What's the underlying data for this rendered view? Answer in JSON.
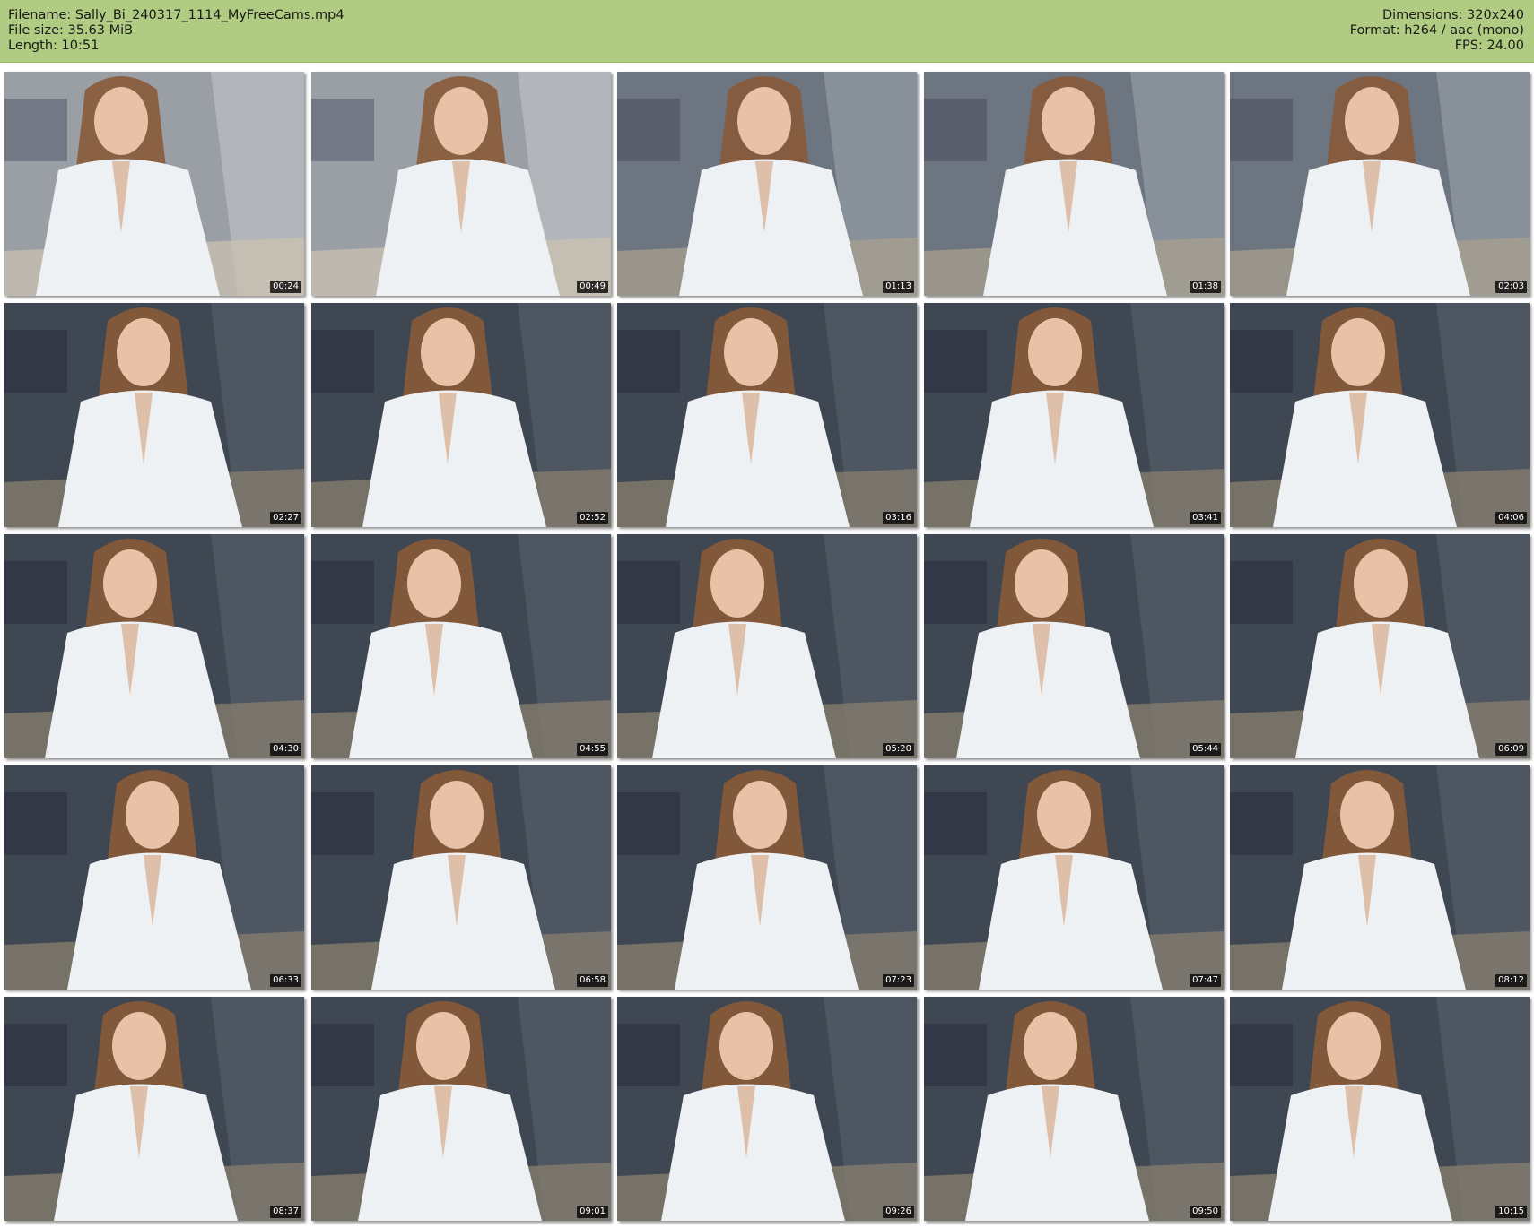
{
  "header": {
    "filename": "Filename: Sally_Bi_240317_1114_MyFreeCams.mp4",
    "filesize": "File size: 35.63 MiB",
    "length": "Length: 10:51",
    "dimensions": "Dimensions: 320x240",
    "format": "Format: h264 / aac (mono)",
    "fps": "FPS: 24.00"
  },
  "thumbnails": [
    {
      "time": "00:24",
      "scene": "light"
    },
    {
      "time": "00:49",
      "scene": "light"
    },
    {
      "time": "01:13",
      "scene": "mid"
    },
    {
      "time": "01:38",
      "scene": "mid"
    },
    {
      "time": "02:03",
      "scene": "mid"
    },
    {
      "time": "02:27",
      "scene": "dark"
    },
    {
      "time": "02:52",
      "scene": "dark"
    },
    {
      "time": "03:16",
      "scene": "dark"
    },
    {
      "time": "03:41",
      "scene": "dark"
    },
    {
      "time": "04:06",
      "scene": "dark"
    },
    {
      "time": "04:30",
      "scene": "dark"
    },
    {
      "time": "04:55",
      "scene": "dark"
    },
    {
      "time": "05:20",
      "scene": "dark"
    },
    {
      "time": "05:44",
      "scene": "dark"
    },
    {
      "time": "06:09",
      "scene": "dark"
    },
    {
      "time": "06:33",
      "scene": "dark"
    },
    {
      "time": "06:58",
      "scene": "dark"
    },
    {
      "time": "07:23",
      "scene": "dark"
    },
    {
      "time": "07:47",
      "scene": "dark"
    },
    {
      "time": "08:12",
      "scene": "dark"
    },
    {
      "time": "08:37",
      "scene": "dark"
    },
    {
      "time": "09:01",
      "scene": "dark"
    },
    {
      "time": "09:26",
      "scene": "dark"
    },
    {
      "time": "09:50",
      "scene": "dark"
    },
    {
      "time": "10:15",
      "scene": "dark"
    }
  ]
}
